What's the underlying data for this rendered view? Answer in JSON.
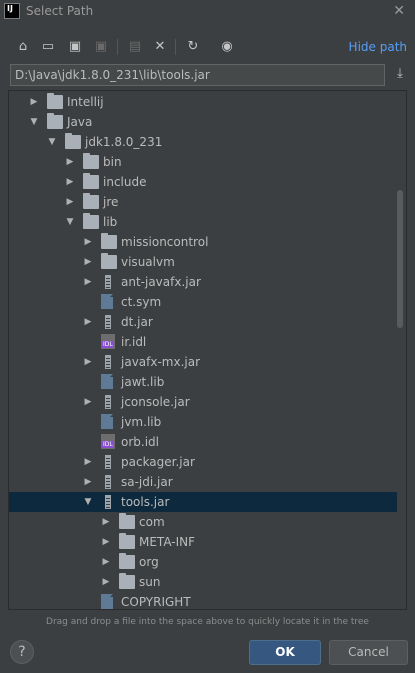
{
  "window": {
    "title": "Select Path",
    "app_icon_text": "IJ"
  },
  "toolbar": {
    "hide_path": "Hide path"
  },
  "path": {
    "value": "D:\\Java\\jdk1.8.0_231\\lib\\tools.jar"
  },
  "tree": {
    "rows": [
      {
        "label": "Intellij",
        "type": "folder",
        "depth": 1,
        "arrow": "▶"
      },
      {
        "label": "Java",
        "type": "folder",
        "depth": 1,
        "arrow": "▼"
      },
      {
        "label": "jdk1.8.0_231",
        "type": "folder",
        "depth": 2,
        "arrow": "▼"
      },
      {
        "label": "bin",
        "type": "folder",
        "depth": 3,
        "arrow": "▶"
      },
      {
        "label": "include",
        "type": "folder",
        "depth": 3,
        "arrow": "▶"
      },
      {
        "label": "jre",
        "type": "folder",
        "depth": 3,
        "arrow": "▶"
      },
      {
        "label": "lib",
        "type": "folder",
        "depth": 3,
        "arrow": "▼"
      },
      {
        "label": "missioncontrol",
        "type": "folder",
        "depth": 4,
        "arrow": "▶"
      },
      {
        "label": "visualvm",
        "type": "folder",
        "depth": 4,
        "arrow": "▶"
      },
      {
        "label": "ant-javafx.jar",
        "type": "jar",
        "depth": 4,
        "arrow": "▶"
      },
      {
        "label": "ct.sym",
        "type": "file",
        "depth": 4,
        "arrow": ""
      },
      {
        "label": "dt.jar",
        "type": "jar",
        "depth": 4,
        "arrow": "▶"
      },
      {
        "label": "ir.idl",
        "type": "idl",
        "depth": 4,
        "arrow": ""
      },
      {
        "label": "javafx-mx.jar",
        "type": "jar",
        "depth": 4,
        "arrow": "▶"
      },
      {
        "label": "jawt.lib",
        "type": "file",
        "depth": 4,
        "arrow": ""
      },
      {
        "label": "jconsole.jar",
        "type": "jar",
        "depth": 4,
        "arrow": "▶"
      },
      {
        "label": "jvm.lib",
        "type": "file",
        "depth": 4,
        "arrow": ""
      },
      {
        "label": "orb.idl",
        "type": "idl",
        "depth": 4,
        "arrow": ""
      },
      {
        "label": "packager.jar",
        "type": "jar",
        "depth": 4,
        "arrow": "▶"
      },
      {
        "label": "sa-jdi.jar",
        "type": "jar",
        "depth": 4,
        "arrow": "▶"
      },
      {
        "label": "tools.jar",
        "type": "jar",
        "depth": 4,
        "arrow": "▼",
        "selected": true
      },
      {
        "label": "com",
        "type": "folder",
        "depth": 5,
        "arrow": "▶"
      },
      {
        "label": "META-INF",
        "type": "folder",
        "depth": 5,
        "arrow": "▶"
      },
      {
        "label": "org",
        "type": "folder",
        "depth": 5,
        "arrow": "▶"
      },
      {
        "label": "sun",
        "type": "folder",
        "depth": 5,
        "arrow": "▶"
      },
      {
        "label": "COPYRIGHT",
        "type": "file",
        "depth": 4,
        "arrow": ""
      }
    ]
  },
  "hint": "Drag and drop a file into the space above to quickly locate it in the tree",
  "buttons": {
    "help": "?",
    "ok": "OK",
    "cancel": "Cancel"
  },
  "colors": {
    "background": "#3c3f41",
    "selection": "#0d293e",
    "link": "#589df6",
    "ok_button": "#365880"
  }
}
